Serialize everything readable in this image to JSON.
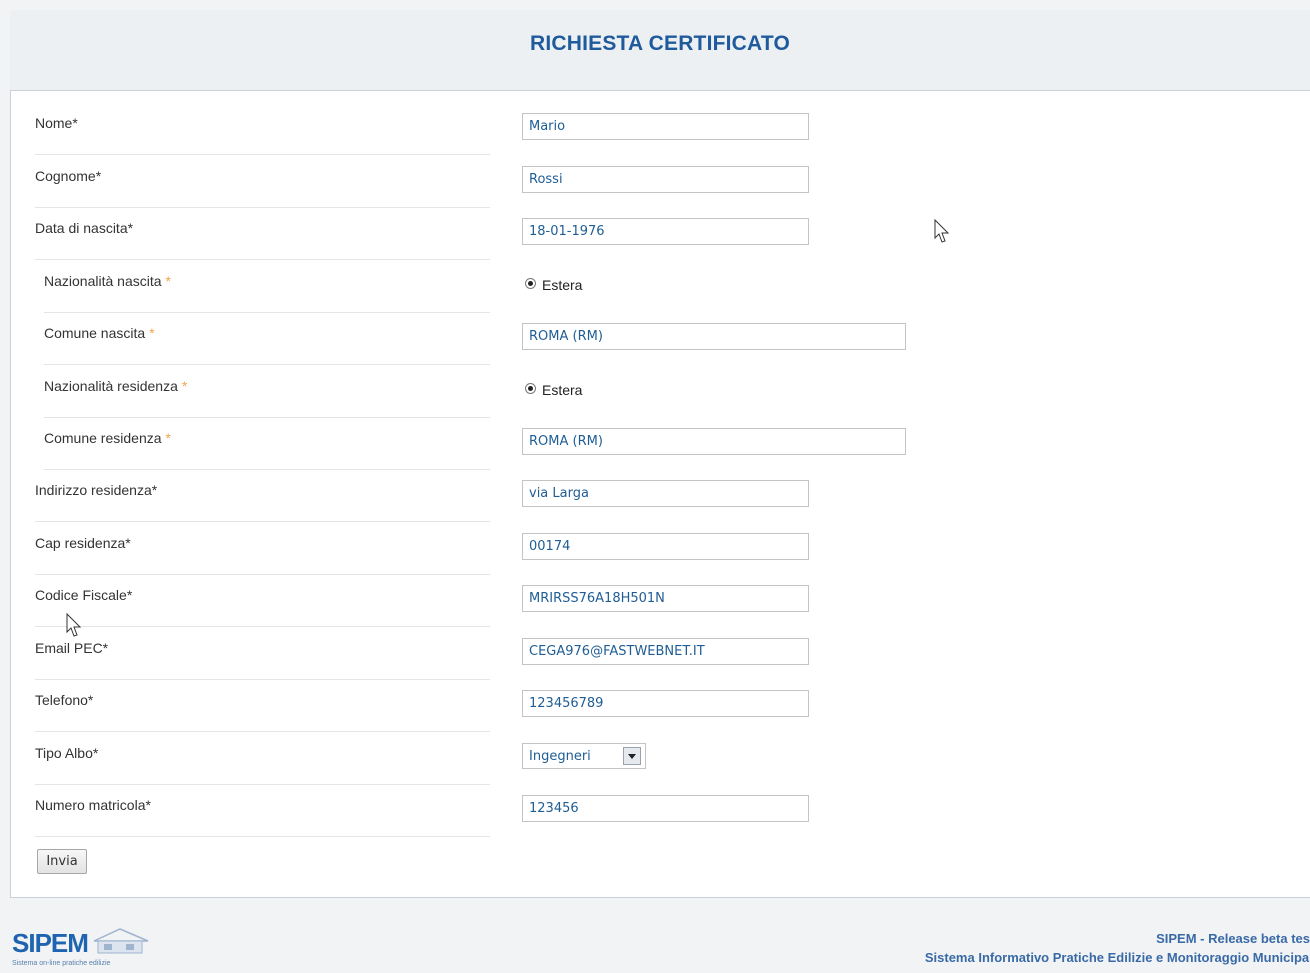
{
  "header": {
    "title": "RICHIESTA CERTIFICATO"
  },
  "form": {
    "nome": {
      "label": "Nome*",
      "value": "Mario"
    },
    "cognome": {
      "label": "Cognome*",
      "value": "Rossi"
    },
    "data_nascita": {
      "label": "Data di nascita*",
      "value": "18-01-1976"
    },
    "nazionalita_nascita": {
      "label": "Nazionalità nascita",
      "required_mark": "*",
      "option": "Estera"
    },
    "comune_nascita": {
      "label": "Comune nascita",
      "required_mark": "*",
      "value": "ROMA (RM)"
    },
    "nazionalita_residenza": {
      "label": "Nazionalità residenza",
      "required_mark": "*",
      "option": "Estera"
    },
    "comune_residenza": {
      "label": "Comune residenza",
      "required_mark": "*",
      "value": "ROMA (RM)"
    },
    "indirizzo_residenza": {
      "label": "Indirizzo residenza*",
      "value": "via Larga"
    },
    "cap_residenza": {
      "label": "Cap residenza*",
      "value": "00174"
    },
    "codice_fiscale": {
      "label": "Codice Fiscale*",
      "value": "MRIRSS76A18H501N"
    },
    "email_pec": {
      "label": "Email PEC*",
      "value": "CEGA976@FASTWEBNET.IT"
    },
    "telefono": {
      "label": "Telefono*",
      "value": "123456789"
    },
    "tipo_albo": {
      "label": "Tipo Albo*",
      "selected": "Ingegneri"
    },
    "numero_matricola": {
      "label": "Numero matricola*",
      "value": "123456"
    },
    "submit_label": "Invia"
  },
  "footer": {
    "logo_text": "SIPEM",
    "logo_tagline": "Sistema on-line pratiche edilizie",
    "line1": "SIPEM - Release beta tes",
    "line2": "Sistema Informativo Pratiche Edilizie e Monitoraggio Municipale"
  },
  "colors": {
    "title": "#1e5a9c",
    "field_text": "#1f5d94",
    "required_mark": "#f0a64a",
    "footer_text": "#3a6aa6"
  },
  "icons": {
    "radio": "radio-selected-icon",
    "select": "chevron-down-icon",
    "cursor": "mouse-pointer-icon",
    "logo": "house-icon"
  }
}
